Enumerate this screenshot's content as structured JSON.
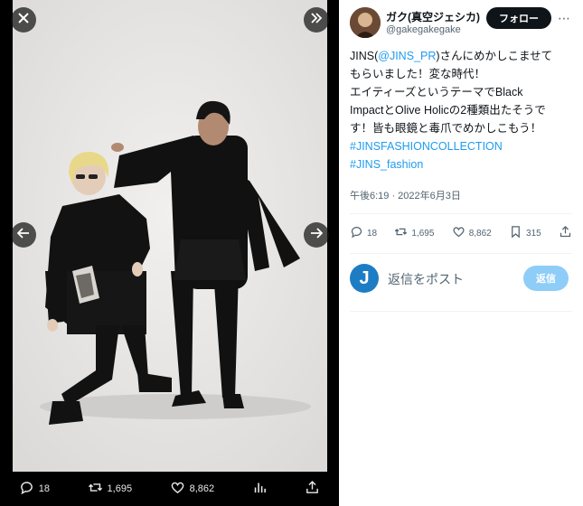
{
  "viewer": {
    "close_icon": "close-icon",
    "expand_icon": "double-chevron-right-icon",
    "prev_icon": "arrow-left-icon",
    "next_icon": "arrow-right-icon",
    "actions": {
      "replies": "18",
      "reposts": "1,695",
      "likes": "8,862"
    }
  },
  "tweet": {
    "author_name": "ガク(真空ジェシカ)",
    "author_handle": "@gakegakegake",
    "follow_label": "フォロー",
    "lines": [
      [
        "JINS(",
        "@JINS_PR",
        ")さんにめかしこませて"
      ],
      [
        "もらいました！変な時代！"
      ],
      [
        "エイティーズというテーマでBlack"
      ],
      [
        "ImpactとOlive Holicの2種類出たそうで"
      ],
      [
        "す！皆も眼鏡と毒爪でめかしこもう！"
      ],
      [
        "#JINSFASHIONCOLLECTION"
      ],
      [
        "#JINS_fashion"
      ]
    ],
    "timestamp": "午後6:19 · 2022年6月3日",
    "stats": {
      "replies": "18",
      "reposts": "1,695",
      "likes": "8,862",
      "bookmarks": "315"
    }
  },
  "reply_box": {
    "placeholder": "返信をポスト",
    "button_label": "返信",
    "avatar_letter": "J"
  },
  "colors": {
    "link": "#1d9bf0",
    "follow_bg": "#0f1419",
    "reply_button_bg": "#8ecdf8"
  }
}
